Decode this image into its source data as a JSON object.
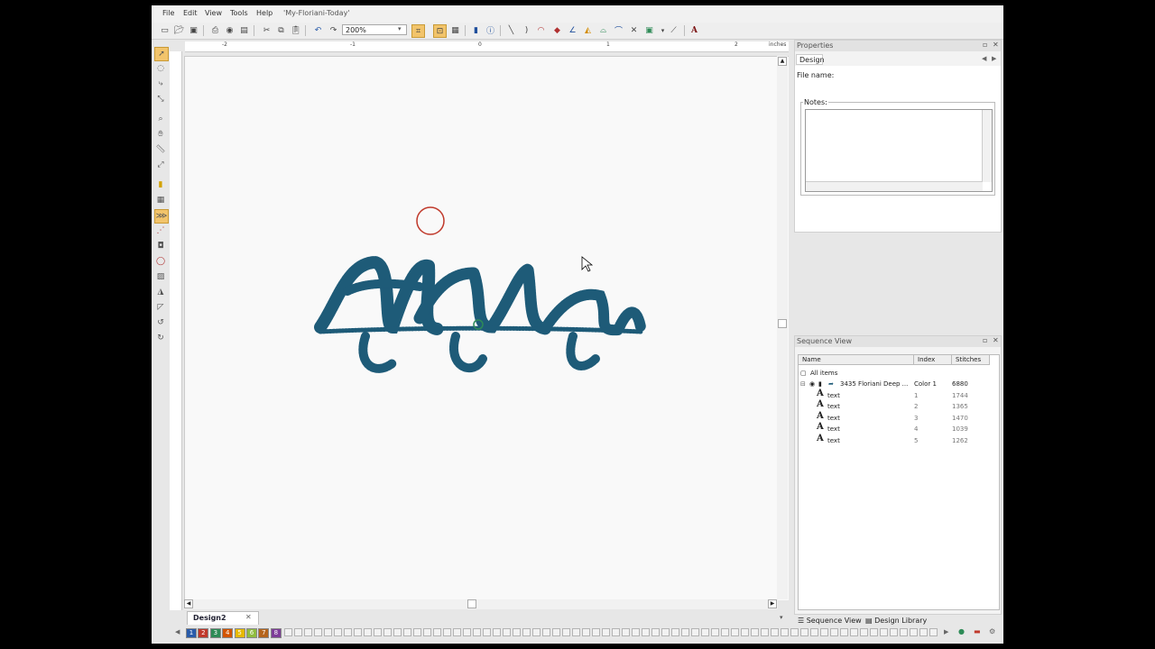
{
  "menu": {
    "items": [
      "File",
      "Edit",
      "View",
      "Tools",
      "Help"
    ],
    "doc_title": "'My-Floriani-Today'"
  },
  "toolbar": {
    "zoom_value": "200%"
  },
  "ruler": {
    "unit": "inches",
    "top_labels": [
      "-2",
      "-1",
      "0",
      "1",
      "2"
    ]
  },
  "properties": {
    "title": "Properties",
    "tab": "Design",
    "file_name_label": "File name:",
    "notes_label": "Notes:"
  },
  "sequence_view": {
    "title": "Sequence View",
    "columns": [
      "Name",
      "Index",
      "Stitches"
    ],
    "root": "All items",
    "group": {
      "name": "3435 Floriani Deep ...",
      "index": "Color 1",
      "stitches": "6880"
    },
    "items": [
      {
        "name": "text",
        "index": "1",
        "stitches": "1744"
      },
      {
        "name": "text",
        "index": "2",
        "stitches": "1365"
      },
      {
        "name": "text",
        "index": "3",
        "stitches": "1470"
      },
      {
        "name": "text",
        "index": "4",
        "stitches": "1039"
      },
      {
        "name": "text",
        "index": "5",
        "stitches": "1262"
      }
    ]
  },
  "bottom_tabs": {
    "seq": "Sequence View",
    "lib": "Design Library"
  },
  "doc_tab": {
    "label": "Design2"
  },
  "palette": {
    "swatches": [
      {
        "label": "1",
        "color": "#2a5caa"
      },
      {
        "label": "2",
        "color": "#c0392b"
      },
      {
        "label": "3",
        "color": "#2e8b57"
      },
      {
        "label": "4",
        "color": "#d35400"
      },
      {
        "label": "5",
        "color": "#e6b800"
      },
      {
        "label": "6",
        "color": "#8fbc3f"
      },
      {
        "label": "7",
        "color": "#b5651d"
      },
      {
        "label": "8",
        "color": "#7d3c98"
      }
    ]
  },
  "colors": {
    "stitch": "#1e5b78",
    "accent_hoop": "#c0392b"
  }
}
